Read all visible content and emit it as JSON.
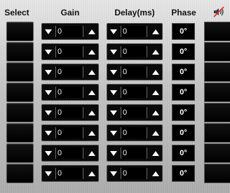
{
  "headers": {
    "select": "Select",
    "gain": "Gain",
    "delay": "Delay(ms)",
    "phase": "Phase",
    "mute_icon": "speaker-muted-icon"
  },
  "rows": [
    {
      "gain": "0",
      "delay": "0",
      "phase": "0°"
    },
    {
      "gain": "0",
      "delay": "0",
      "phase": "0°"
    },
    {
      "gain": "0",
      "delay": "0",
      "phase": "0°"
    },
    {
      "gain": "0",
      "delay": "0",
      "phase": "0°"
    },
    {
      "gain": "0",
      "delay": "0",
      "phase": "0°"
    },
    {
      "gain": "0",
      "delay": "0",
      "phase": "0°"
    },
    {
      "gain": "0",
      "delay": "0",
      "phase": "0°"
    },
    {
      "gain": "0",
      "delay": "0",
      "phase": "0°"
    }
  ],
  "colors": {
    "panel": "#c4c4c4",
    "control": "#000000",
    "text": "#ffffff",
    "mute_icon_strike": "#e03030"
  }
}
